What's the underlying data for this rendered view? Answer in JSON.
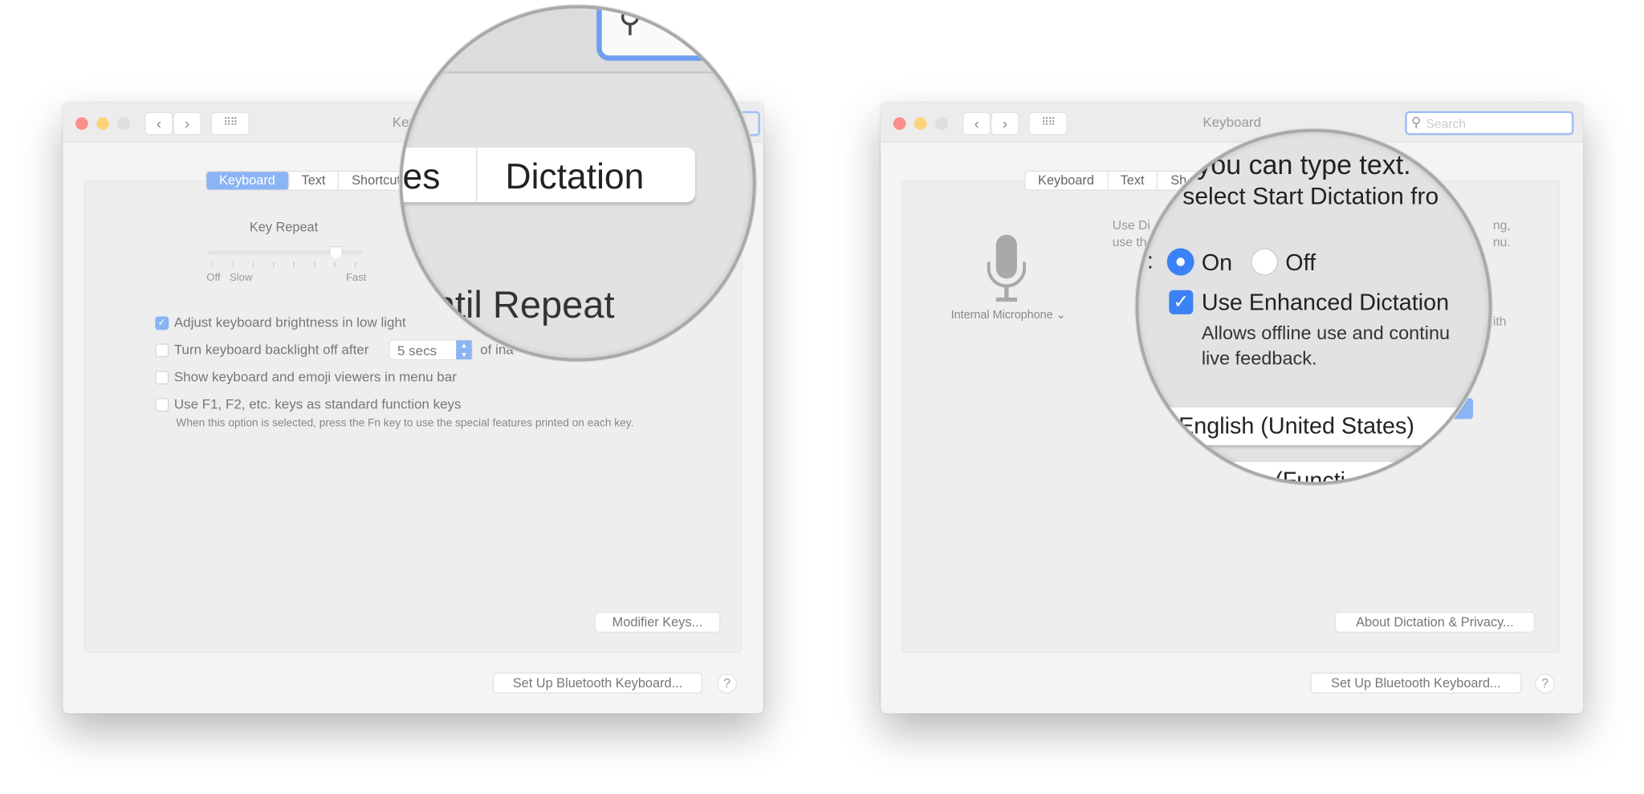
{
  "left_window": {
    "title": "Keyboard",
    "nav": {
      "back_icon": "chevron-left",
      "forward_icon": "chevron-right",
      "grid_icon": "grid"
    },
    "tabs": [
      {
        "label": "Keyboard",
        "selected": true
      },
      {
        "label": "Text"
      },
      {
        "label": "Shortcuts"
      }
    ],
    "key_repeat": {
      "label": "Key Repeat",
      "ticks": [
        "Off",
        "Slow",
        "Fast"
      ],
      "value_step": 7,
      "steps": 8
    },
    "options": [
      {
        "label": "Adjust keyboard brightness in low light",
        "checked": true
      },
      {
        "label": "Turn keyboard backlight off after",
        "checked": false,
        "select_value": "5 secs",
        "suffix": "of ina"
      },
      {
        "label": "Show keyboard and emoji viewers in menu bar",
        "checked": false
      },
      {
        "label": "Use F1, F2, etc. keys as standard function keys",
        "checked": false
      }
    ],
    "fn_note": "When this option is selected, press the Fn key to use the special features printed on each key.",
    "modifier_button": "Modifier Keys...",
    "bluetooth_button": "Set Up Bluetooth Keyboard...",
    "help": "?"
  },
  "left_magnifier": {
    "tab_partial": "es",
    "tab_dictation": "Dictation",
    "text": "ntil Repeat"
  },
  "right_window": {
    "title": "Keyboard",
    "search_placeholder": "Search",
    "tabs": [
      {
        "label": "Keyboard"
      },
      {
        "label": "Text"
      },
      {
        "label": "Sh"
      }
    ],
    "microphone": "Internal Microphone",
    "desc_line1_start": "Use Di",
    "desc_line1_end": "ng,",
    "desc_line2_start": "use th",
    "desc_line2_end": "nu.",
    "enhanced_tail": "ith",
    "about_button": "About Dictation & Privacy...",
    "bluetooth_button": "Set Up Bluetooth Keyboard...",
    "help": "?"
  },
  "right_magnifier": {
    "line1": "r you can type text.",
    "line2": "select Start Dictation fro",
    "colon": ":",
    "radio_on": "On",
    "radio_off": "Off",
    "dictation_state": "On",
    "enhanced_label": "Use Enhanced Dictation",
    "enhanced_checked": true,
    "enhanced_desc1": "Allows offline use and continu",
    "enhanced_desc2": "live feedback.",
    "language": "English (United States)",
    "shortcut_partial": "(Functi"
  },
  "colors": {
    "accent": "#3b82f6",
    "tab_selected": "#8ab4f4",
    "close": "#fc6058",
    "minimize": "#fdbc40"
  }
}
